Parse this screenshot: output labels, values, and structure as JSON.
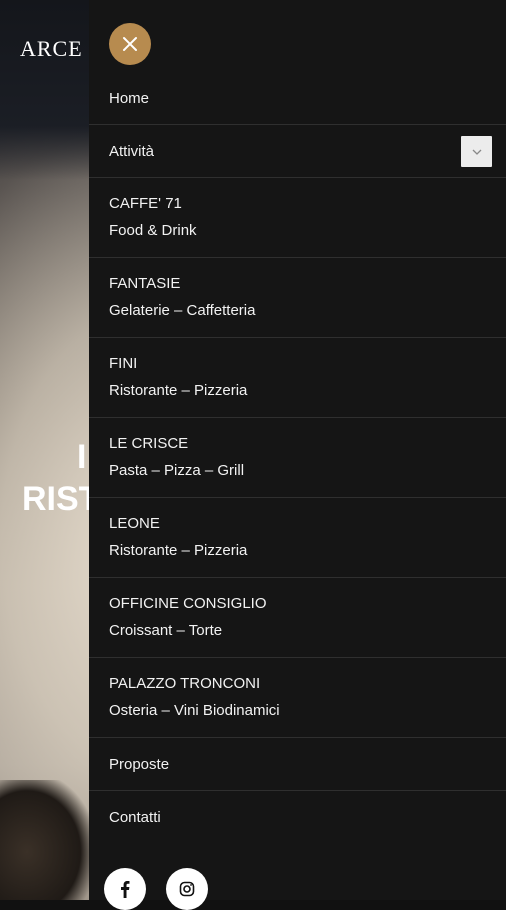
{
  "background": {
    "logo_text": "ARCE",
    "hero_line1": "I",
    "hero_line2": "RIST"
  },
  "drawer": {
    "close_icon": "close-icon",
    "accent_color": "#b78b4f",
    "items": [
      {
        "line1": "Home"
      },
      {
        "line1": "Attività",
        "has_submenu": true
      },
      {
        "line1": "CAFFE' 71",
        "line2": "Food & Drink"
      },
      {
        "line1": "FANTASIE",
        "line2": "Gelaterie – Caffetteria"
      },
      {
        "line1": "FINI",
        "line2": "Ristorante – Pizzeria"
      },
      {
        "line1": "LE CRISCE",
        "line2": "Pasta – Pizza – Grill"
      },
      {
        "line1": "LEONE",
        "line2": "Ristorante – Pizzeria"
      },
      {
        "line1": "OFFICINE CONSIGLIO",
        "line2": "Croissant – Torte"
      },
      {
        "line1": "PALAZZO TRONCONI",
        "line2": "Osteria – Vini Biodinamici"
      },
      {
        "line1": "Proposte"
      },
      {
        "line1": "Contatti"
      }
    ],
    "social_icons": [
      "facebook-icon",
      "instagram-icon"
    ]
  }
}
